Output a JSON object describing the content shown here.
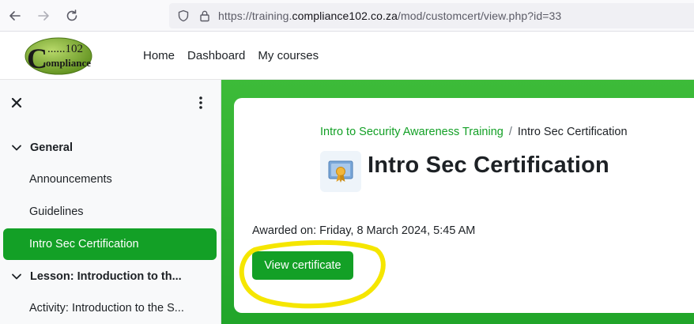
{
  "browser": {
    "url_prefix": "https://training.",
    "url_domain": "compliance102.co.za",
    "url_path": "/mod/customcert/view.php?id=33",
    "icons": [
      "back-arrow-icon",
      "forward-arrow-icon",
      "reload-icon",
      "shield-icon",
      "lock-icon"
    ]
  },
  "site": {
    "logo_text_top": "......102",
    "logo_text_bottom": "ompliance",
    "logo_letter": "C",
    "nav": [
      "Home",
      "Dashboard",
      "My courses"
    ]
  },
  "drawer": {
    "sections": [
      {
        "title": "General",
        "items": [
          "Announcements",
          "Guidelines",
          "Intro Sec Certification"
        ]
      },
      {
        "title": "Lesson: Introduction to th...",
        "items": [
          "Activity: Introduction to the S..."
        ]
      }
    ],
    "active_item": "Intro Sec Certification"
  },
  "page": {
    "breadcrumb_course": "Intro to Security Awareness Training",
    "breadcrumb_separator": "/",
    "breadcrumb_current": "Intro Sec Certification",
    "title": "Intro Sec Certification",
    "awarded": "Awarded on: Friday, 8 March 2024, 5:45 AM",
    "button_label": "View certificate"
  },
  "colors": {
    "brand_green": "#13a026",
    "background_green": "#2fae31",
    "annotation_yellow": "#f5e600"
  }
}
